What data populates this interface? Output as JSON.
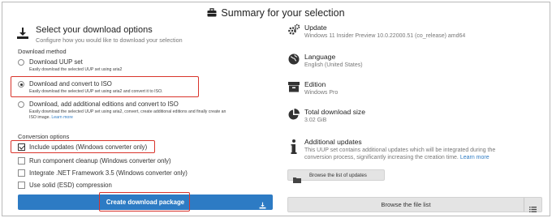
{
  "header": {
    "title": "Summary for your selection"
  },
  "left": {
    "title": "Select your download options",
    "subtitle": "Configure how you would like to download your selection",
    "download_method_label": "Download method",
    "methods": [
      {
        "label": "Download UUP set",
        "desc1": "Easily download the selected UUP set using aria2",
        "desc2": "",
        "checked": false
      },
      {
        "label": "Download and convert to ISO",
        "desc1": "Easily download the selected UUP set using aria2 and convert it to ISO.",
        "desc2": "",
        "checked": true
      },
      {
        "label": "Download, add additional editions and convert to ISO",
        "desc1": "Easily download the selected UUP set using aria2, convert, create additional editions and finally create an",
        "desc2": "ISO image.",
        "link": "Learn more",
        "checked": false
      }
    ],
    "conversion_label": "Conversion options",
    "conversions": [
      {
        "label": "Include updates (Windows converter only)",
        "checked": true
      },
      {
        "label": "Run component cleanup (Windows converter only)",
        "checked": false
      },
      {
        "label": "Integrate .NET Framework 3.5 (Windows converter only)",
        "checked": false
      },
      {
        "label": "Use solid (ESD) compression",
        "checked": false
      }
    ],
    "create_button": "Create download package"
  },
  "right": {
    "update": {
      "key": "Update",
      "value": "Windows 11 Insider Preview 10.0.22000.51 (co_release) amd64"
    },
    "language": {
      "key": "Language",
      "value": "English (United States)"
    },
    "edition": {
      "key": "Edition",
      "value": "Windows Pro"
    },
    "size": {
      "key": "Total download size",
      "value": "3.02 GiB"
    },
    "additional": {
      "key": "Additional updates",
      "line1": "This UUP set contains additional updates which will be integrated during the",
      "line2": "conversion process, significantly increasing the creation time.",
      "link": "Learn more"
    },
    "browse_updates": "Browse the list of updates",
    "browse_files": "Browse the file list"
  },
  "colors": {
    "accent": "#2d7bc4",
    "highlight": "#d9342b",
    "link": "#2f7cc4"
  }
}
